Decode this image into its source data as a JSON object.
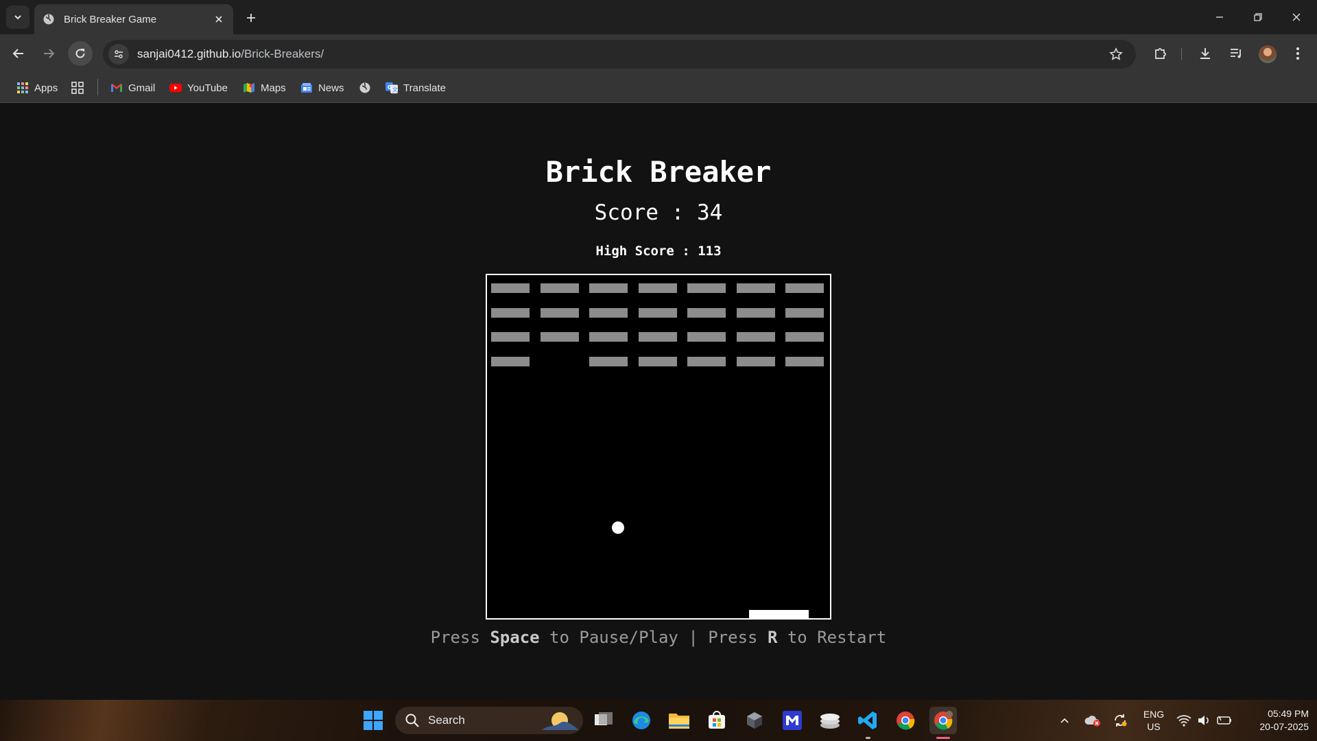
{
  "browser": {
    "tab_title": "Brick Breaker Game",
    "url_host": "sanjai0412.github.io",
    "url_path": "/Brick-Breakers/"
  },
  "bookmarks": [
    {
      "label": "Apps",
      "icon": "apps-grid-icon"
    },
    {
      "label": "",
      "icon": "tab-groups-icon"
    },
    {
      "label": "Gmail",
      "icon": "gmail-icon"
    },
    {
      "label": "YouTube",
      "icon": "youtube-icon"
    },
    {
      "label": "Maps",
      "icon": "maps-icon"
    },
    {
      "label": "News",
      "icon": "news-icon"
    },
    {
      "label": "",
      "icon": "globe-icon"
    },
    {
      "label": "Translate",
      "icon": "translate-icon"
    }
  ],
  "game": {
    "title": "Brick Breaker",
    "score_text": "Score : 34",
    "high_score_text": "High Score : 113",
    "hint_press1": "Press ",
    "hint_key1": "Space",
    "hint_mid": " to Pause/Play | Press ",
    "hint_key2": "R",
    "hint_end": " to Restart",
    "brick_rows": [
      [
        1,
        1,
        1,
        1,
        1,
        1,
        1
      ],
      [
        1,
        1,
        1,
        1,
        1,
        1,
        1
      ],
      [
        1,
        1,
        1,
        1,
        1,
        1,
        1
      ],
      [
        1,
        0,
        1,
        1,
        1,
        1,
        1
      ]
    ],
    "colors": {
      "brick": "#8c8c8c",
      "board": "#000000",
      "ball": "#ffffff",
      "paddle": "#ffffff"
    }
  },
  "taskbar": {
    "search_label": "Search",
    "lang_line1": "ENG",
    "lang_line2": "US",
    "time": "05:49 PM",
    "date": "20-07-2025"
  }
}
